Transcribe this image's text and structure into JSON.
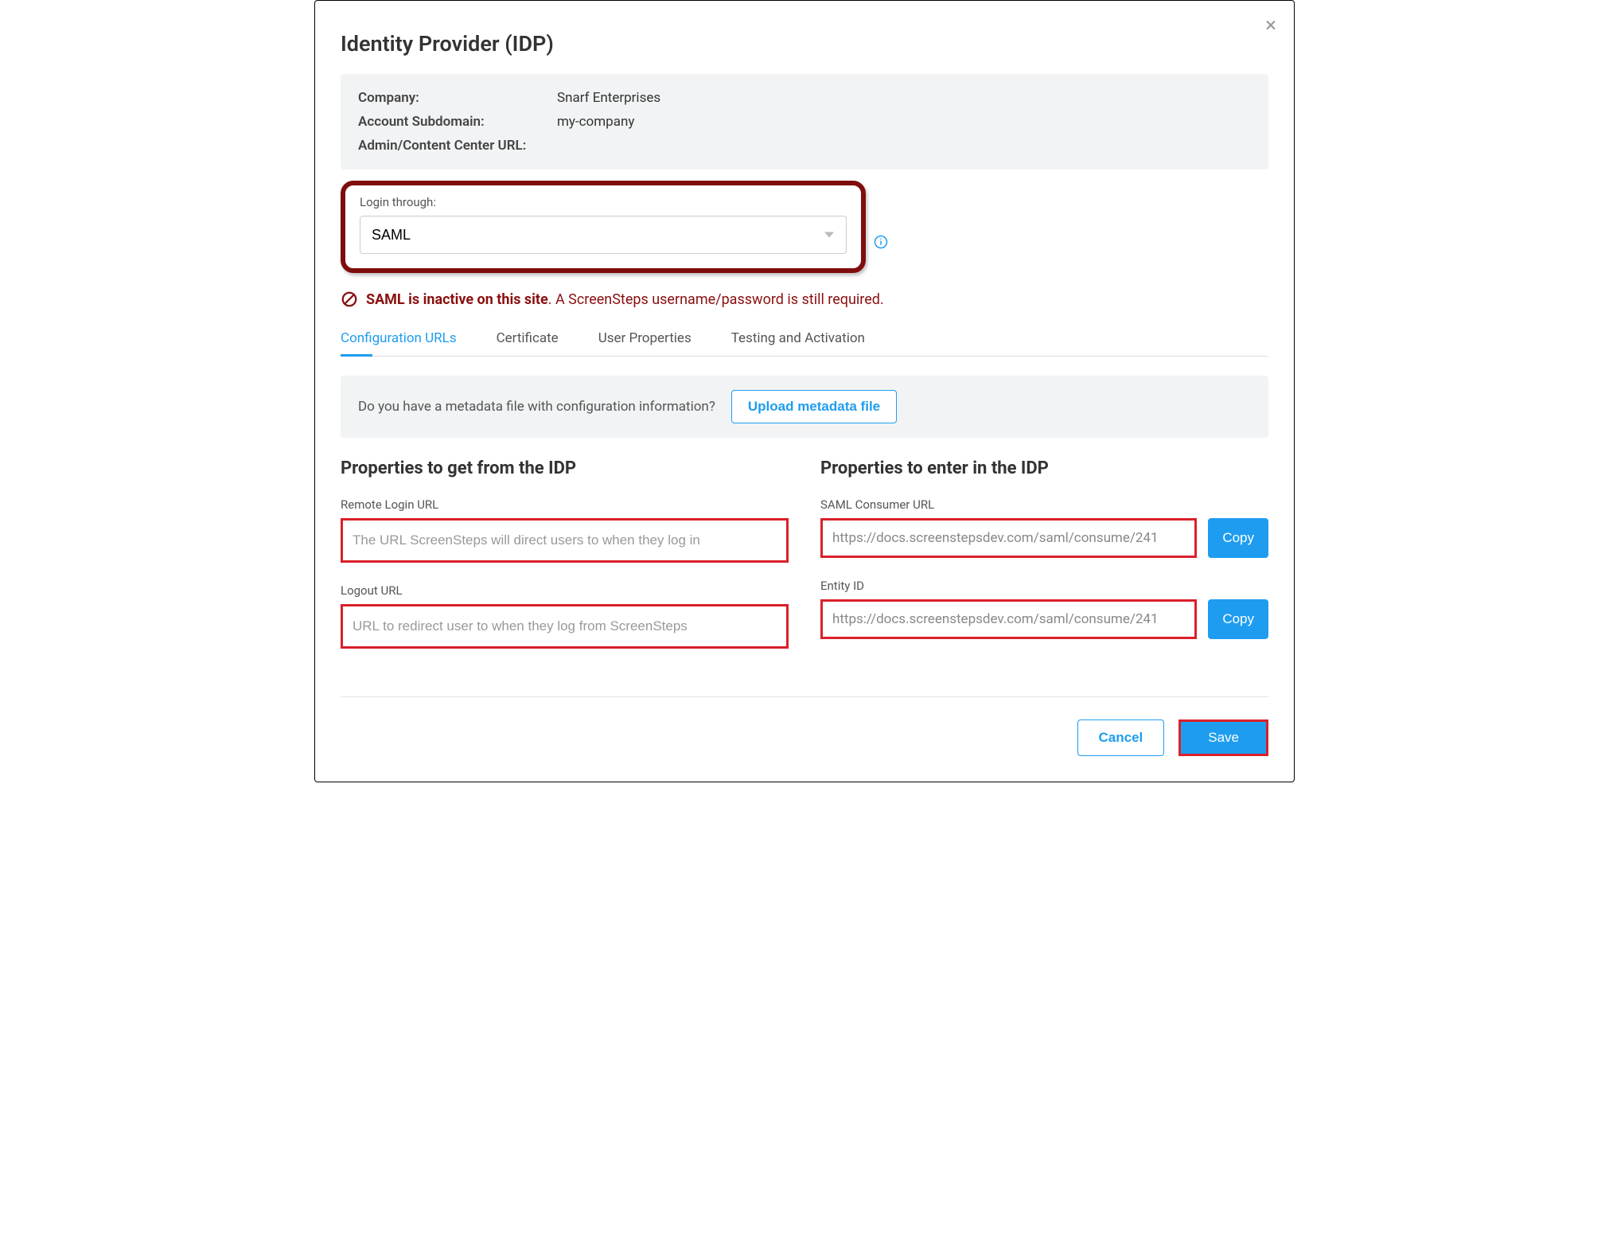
{
  "header": {
    "title": "Identity Provider (IDP)"
  },
  "info": {
    "company_label": "Company:",
    "company_value": "Snarf Enterprises",
    "subdomain_label": "Account Subdomain:",
    "subdomain_value": "my-company",
    "admin_url_label": "Admin/Content Center URL:",
    "admin_url_value": ""
  },
  "login": {
    "label": "Login through:",
    "selected": "SAML"
  },
  "alert": {
    "bold": "SAML is inactive on this site",
    "rest": ". A ScreenSteps username/password is still required."
  },
  "tabs": {
    "config": "Configuration URLs",
    "cert": "Certificate",
    "user_props": "User Properties",
    "testing": "Testing and Activation"
  },
  "metadata": {
    "question": "Do you have a metadata file with configuration information?",
    "upload_label": "Upload metadata file"
  },
  "left": {
    "heading": "Properties to get from the IDP",
    "remote_login_label": "Remote Login URL",
    "remote_login_placeholder": "The URL ScreenSteps will direct users to when they log in",
    "logout_label": "Logout URL",
    "logout_placeholder": "URL to redirect user to when they log from ScreenSteps"
  },
  "right": {
    "heading": "Properties to enter in the IDP",
    "consumer_label": "SAML Consumer URL",
    "consumer_value": "https://docs.screenstepsdev.com/saml/consume/241",
    "entity_label": "Entity ID",
    "entity_value": "https://docs.screenstepsdev.com/saml/consume/241",
    "copy_label": "Copy"
  },
  "footer": {
    "cancel": "Cancel",
    "save": "Save"
  }
}
